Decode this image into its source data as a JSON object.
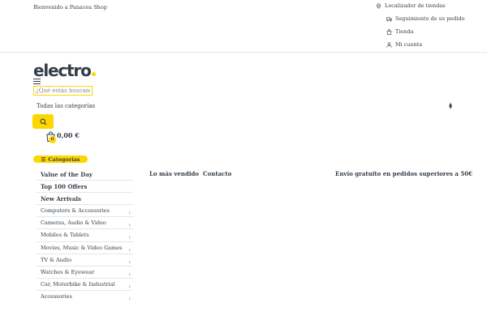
{
  "topbar": {
    "welcome": "Bienvenido a Panacea Shop",
    "links": [
      {
        "label": "Localizador de tiendas",
        "icon": "map-pin-icon"
      },
      {
        "label": "Seguimiento de su pedido",
        "icon": "truck-icon"
      },
      {
        "label": "Tienda",
        "icon": "bag-icon"
      },
      {
        "label": "Mi cuenta",
        "icon": "user-icon"
      }
    ]
  },
  "header": {
    "logo": "electro",
    "search": {
      "placeholder": "¿Qué estás buscando...",
      "category": "Todas las categorías"
    },
    "cart": {
      "count": "0",
      "total": "0,00 €"
    }
  },
  "sidebar": {
    "header": "Categorías",
    "items": [
      {
        "label": "Value of the Day",
        "bold": true,
        "chevron": false
      },
      {
        "label": "Top 100 Offers",
        "bold": true,
        "chevron": false
      },
      {
        "label": "New Arrivals",
        "bold": true,
        "chevron": false
      },
      {
        "label": "Computers & Accessories",
        "bold": false,
        "chevron": true
      },
      {
        "label": "Cameras, Audio & Video",
        "bold": false,
        "chevron": true
      },
      {
        "label": "Mobiles & Tablets",
        "bold": false,
        "chevron": true
      },
      {
        "label": "Movies, Music & Video Games",
        "bold": false,
        "chevron": true
      },
      {
        "label": "TV & Audio",
        "bold": false,
        "chevron": true
      },
      {
        "label": "Watches & Eyewear",
        "bold": false,
        "chevron": true
      },
      {
        "label": "Car, Motorbike & Industrial",
        "bold": false,
        "chevron": true
      },
      {
        "label": "Accessories",
        "bold": false,
        "chevron": true
      }
    ]
  },
  "nav": {
    "best_sellers": "Lo más vendido",
    "contact": "Contacto",
    "shipping": "Envío gratuito en pedidos superiores a 50€"
  },
  "colors": {
    "accent": "#fed700",
    "text": "#333e48",
    "border": "#e6e6e6"
  }
}
